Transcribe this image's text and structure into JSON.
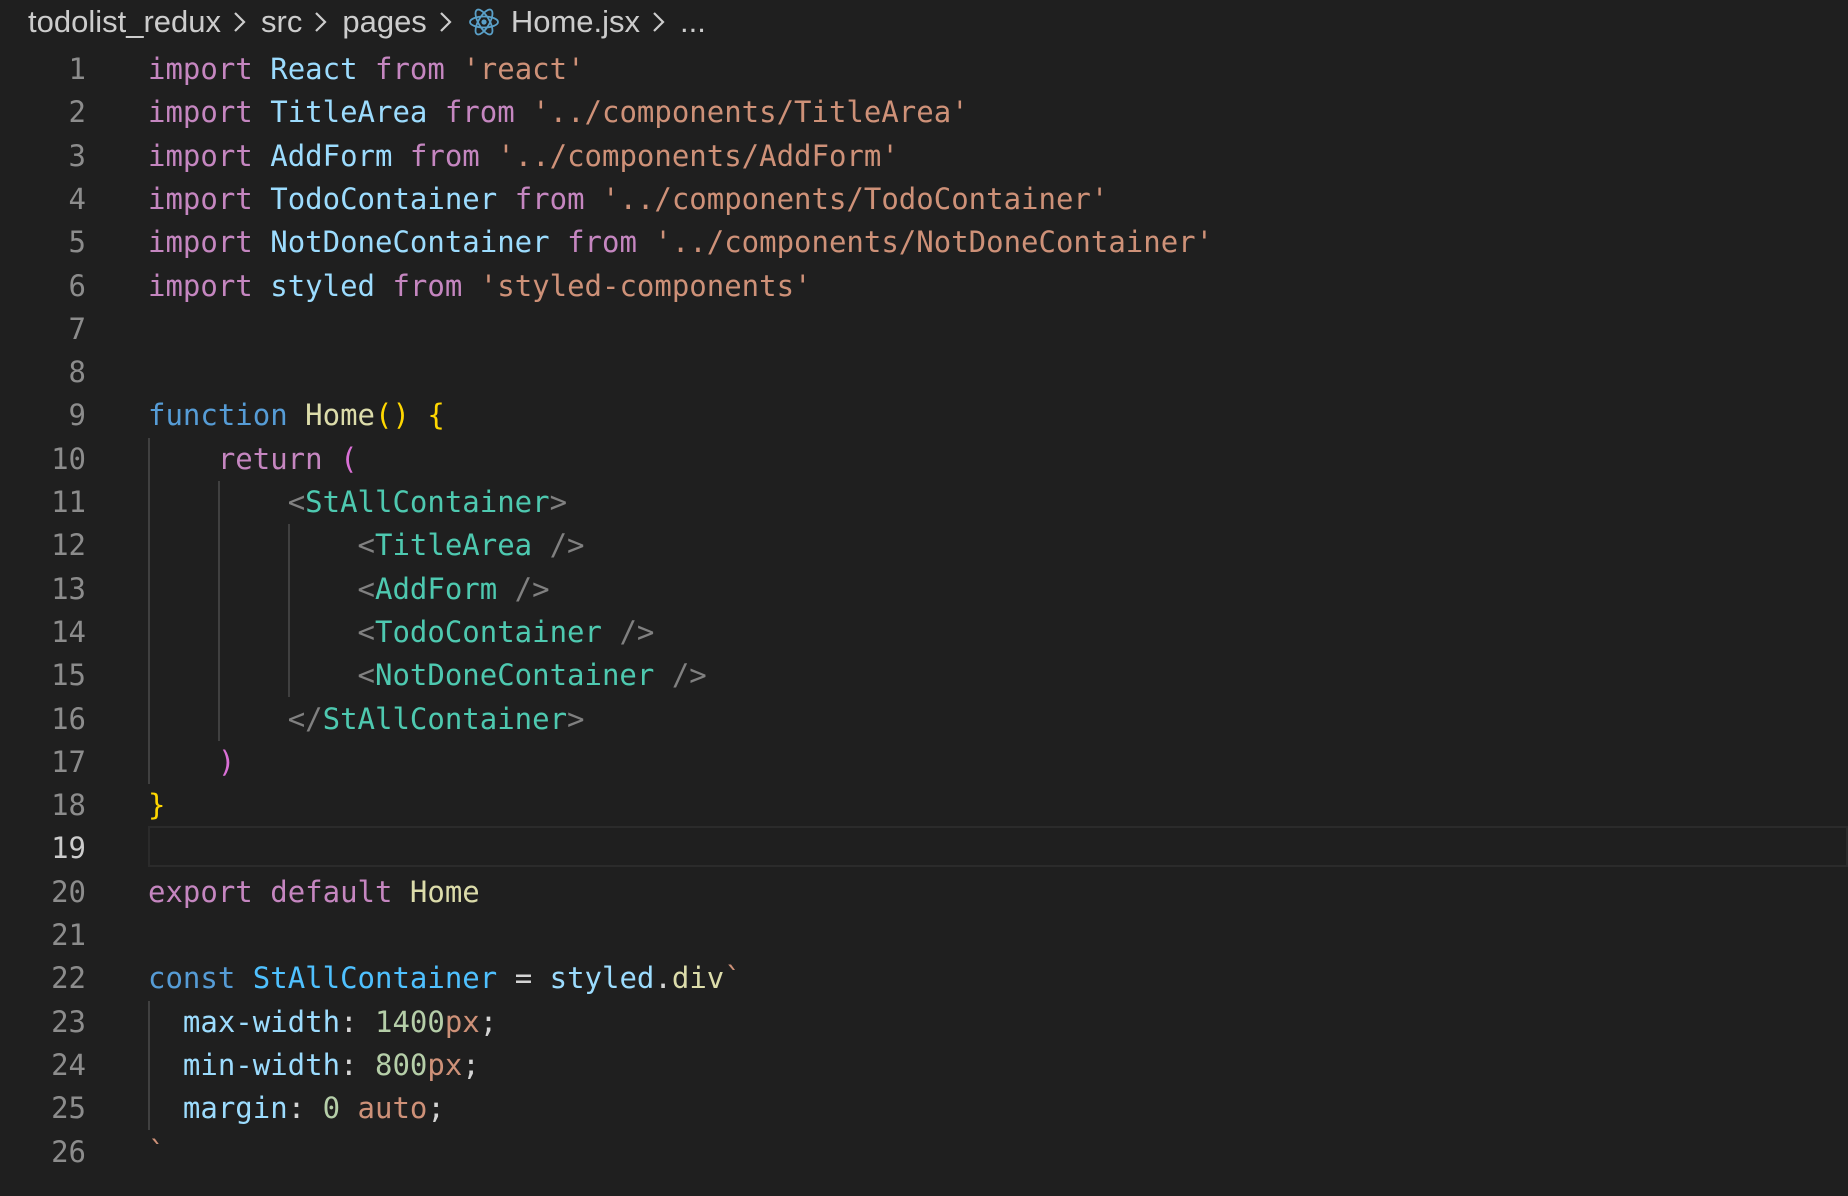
{
  "breadcrumb": {
    "items": [
      "todolist_redux",
      "src",
      "pages",
      "Home.jsx",
      "..."
    ],
    "file_icon": "react-icon",
    "separator_icon": "chevron-right-icon"
  },
  "editor": {
    "active_line": 19,
    "line_numbers": [
      "1",
      "2",
      "3",
      "4",
      "5",
      "6",
      "7",
      "8",
      "9",
      "10",
      "11",
      "12",
      "13",
      "14",
      "15",
      "16",
      "17",
      "18",
      "19",
      "20",
      "21",
      "22",
      "23",
      "24",
      "25",
      "26"
    ],
    "code": [
      [
        [
          "import",
          "k-ctl"
        ],
        [
          " ",
          "plain"
        ],
        [
          "React",
          "var"
        ],
        [
          " ",
          "plain"
        ],
        [
          "from",
          "k-ctl"
        ],
        [
          " ",
          "plain"
        ],
        [
          "'react'",
          "str"
        ]
      ],
      [
        [
          "import",
          "k-ctl"
        ],
        [
          " ",
          "plain"
        ],
        [
          "TitleArea",
          "var"
        ],
        [
          " ",
          "plain"
        ],
        [
          "from",
          "k-ctl"
        ],
        [
          " ",
          "plain"
        ],
        [
          "'../components/TitleArea'",
          "str"
        ]
      ],
      [
        [
          "import",
          "k-ctl"
        ],
        [
          " ",
          "plain"
        ],
        [
          "AddForm",
          "var"
        ],
        [
          " ",
          "plain"
        ],
        [
          "from",
          "k-ctl"
        ],
        [
          " ",
          "plain"
        ],
        [
          "'../components/AddForm'",
          "str"
        ]
      ],
      [
        [
          "import",
          "k-ctl"
        ],
        [
          " ",
          "plain"
        ],
        [
          "TodoContainer",
          "var"
        ],
        [
          " ",
          "plain"
        ],
        [
          "from",
          "k-ctl"
        ],
        [
          " ",
          "plain"
        ],
        [
          "'../components/TodoContainer'",
          "str"
        ]
      ],
      [
        [
          "import",
          "k-ctl"
        ],
        [
          " ",
          "plain"
        ],
        [
          "NotDoneContainer",
          "var"
        ],
        [
          " ",
          "plain"
        ],
        [
          "from",
          "k-ctl"
        ],
        [
          " ",
          "plain"
        ],
        [
          "'../components/NotDoneContainer'",
          "str"
        ]
      ],
      [
        [
          "import",
          "k-ctl"
        ],
        [
          " ",
          "plain"
        ],
        [
          "styled",
          "var"
        ],
        [
          " ",
          "plain"
        ],
        [
          "from",
          "k-ctl"
        ],
        [
          " ",
          "plain"
        ],
        [
          "'styled-components'",
          "str"
        ]
      ],
      [],
      [],
      [
        [
          "function",
          "k-dec"
        ],
        [
          " ",
          "plain"
        ],
        [
          "Home",
          "fn"
        ],
        [
          "()",
          "br1"
        ],
        [
          " ",
          "plain"
        ],
        [
          "{",
          "br1"
        ]
      ],
      [
        [
          "    ",
          "plain"
        ],
        [
          "return",
          "k-ctl"
        ],
        [
          " ",
          "plain"
        ],
        [
          "(",
          "br2"
        ]
      ],
      [
        [
          "        ",
          "plain"
        ],
        [
          "<",
          "pun"
        ],
        [
          "StAllContainer",
          "tag"
        ],
        [
          ">",
          "pun"
        ]
      ],
      [
        [
          "            ",
          "plain"
        ],
        [
          "<",
          "pun"
        ],
        [
          "TitleArea",
          "tag"
        ],
        [
          " ",
          "plain"
        ],
        [
          "/>",
          "pun"
        ]
      ],
      [
        [
          "            ",
          "plain"
        ],
        [
          "<",
          "pun"
        ],
        [
          "AddForm",
          "tag"
        ],
        [
          " ",
          "plain"
        ],
        [
          "/>",
          "pun"
        ]
      ],
      [
        [
          "            ",
          "plain"
        ],
        [
          "<",
          "pun"
        ],
        [
          "TodoContainer",
          "tag"
        ],
        [
          " ",
          "plain"
        ],
        [
          "/>",
          "pun"
        ]
      ],
      [
        [
          "            ",
          "plain"
        ],
        [
          "<",
          "pun"
        ],
        [
          "NotDoneContainer",
          "tag"
        ],
        [
          " ",
          "plain"
        ],
        [
          "/>",
          "pun"
        ]
      ],
      [
        [
          "        ",
          "plain"
        ],
        [
          "</",
          "pun"
        ],
        [
          "StAllContainer",
          "tag"
        ],
        [
          ">",
          "pun"
        ]
      ],
      [
        [
          "    ",
          "plain"
        ],
        [
          ")",
          "br2"
        ]
      ],
      [
        [
          "}",
          "br1"
        ]
      ],
      [],
      [
        [
          "export",
          "k-ctl"
        ],
        [
          " ",
          "plain"
        ],
        [
          "default",
          "k-ctl"
        ],
        [
          " ",
          "plain"
        ],
        [
          "Home",
          "fn"
        ]
      ],
      [],
      [
        [
          "const",
          "k-dec"
        ],
        [
          " ",
          "plain"
        ],
        [
          "StAllContainer",
          "cvar"
        ],
        [
          " ",
          "plain"
        ],
        [
          "=",
          "plain"
        ],
        [
          " ",
          "plain"
        ],
        [
          "styled",
          "var"
        ],
        [
          ".",
          "plain"
        ],
        [
          "div",
          "fn"
        ],
        [
          "`",
          "str"
        ]
      ],
      [
        [
          "  ",
          "plain"
        ],
        [
          "max-width",
          "prop"
        ],
        [
          ": ",
          "plain"
        ],
        [
          "1400",
          "num"
        ],
        [
          "px",
          "str"
        ],
        [
          ";",
          "plain"
        ]
      ],
      [
        [
          "  ",
          "plain"
        ],
        [
          "min-width",
          "prop"
        ],
        [
          ": ",
          "plain"
        ],
        [
          "800",
          "num"
        ],
        [
          "px",
          "str"
        ],
        [
          ";",
          "plain"
        ]
      ],
      [
        [
          "  ",
          "plain"
        ],
        [
          "margin",
          "prop"
        ],
        [
          ": ",
          "plain"
        ],
        [
          "0",
          "num"
        ],
        [
          " ",
          "plain"
        ],
        [
          "auto",
          "str"
        ],
        [
          ";",
          "plain"
        ]
      ],
      [
        [
          "`",
          "str"
        ]
      ]
    ]
  }
}
